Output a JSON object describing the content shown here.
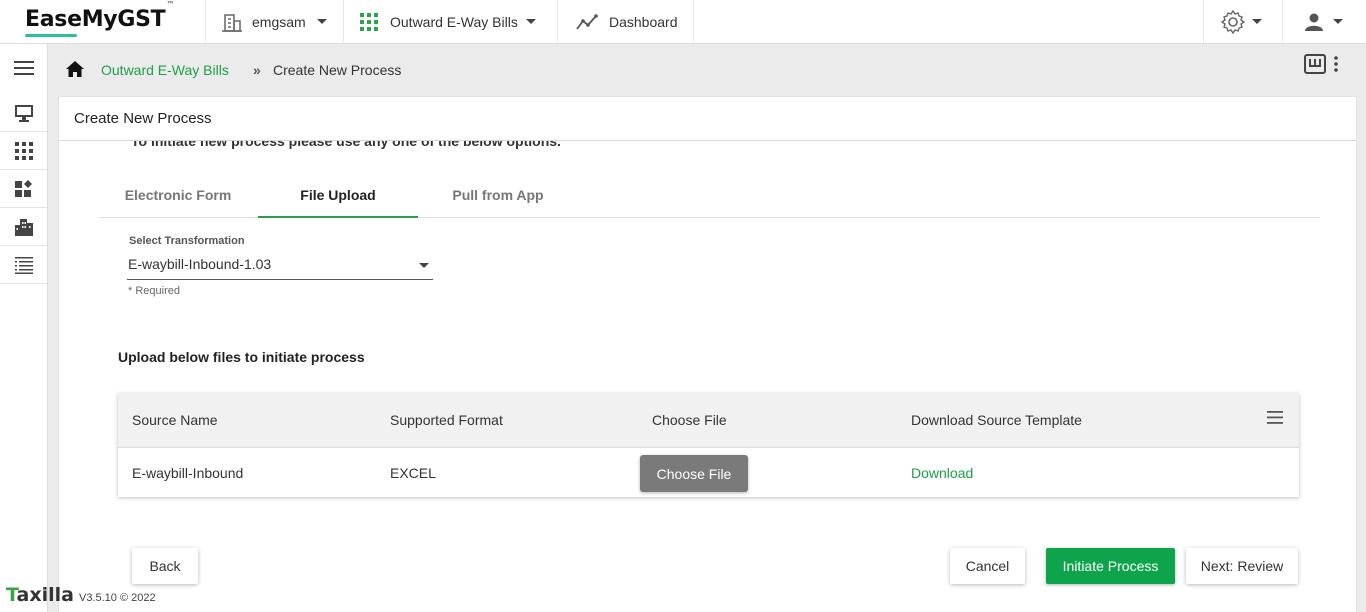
{
  "app": {
    "name": "EaseMyGST",
    "trademark": "™"
  },
  "topbar": {
    "org": "emgsam",
    "module": "Outward E-Way Bills",
    "dashboard": "Dashboard"
  },
  "breadcrumb": {
    "link": "Outward E-Way Bills",
    "separator": "»",
    "current": "Create New Process"
  },
  "card": {
    "title": "Create New Process",
    "intro": "To initiate new process please use any one of the below options."
  },
  "tabs": [
    {
      "label": "Electronic Form",
      "active": false
    },
    {
      "label": "File Upload",
      "active": true
    },
    {
      "label": "Pull from App",
      "active": false
    }
  ],
  "transformation": {
    "label": "Select Transformation",
    "value": "E-waybill-Inbound-1.03",
    "hint": "* Required"
  },
  "upload": {
    "heading": "Upload below files to initiate process",
    "columns": [
      "Source Name",
      "Supported Format",
      "Choose File",
      "Download Source Template"
    ],
    "rows": [
      {
        "source": "E-waybill-Inbound",
        "format": "EXCEL",
        "choose": "Choose File",
        "download": "Download"
      }
    ]
  },
  "actions": {
    "back": "Back",
    "cancel": "Cancel",
    "initiate": "Initiate Process",
    "next": "Next: Review"
  },
  "footer": {
    "brand_lead": "T",
    "brand_rest": "axilla",
    "version": "V3.5.10 © 2022"
  },
  "colors": {
    "accent": "#0ea44b",
    "link": "#1e9e4a",
    "logo_underline": "#2bbfa0"
  },
  "icons": [
    "building-icon",
    "grid-icon",
    "trend-icon",
    "gear-icon",
    "user-icon",
    "hamburger-icon",
    "monitor-icon",
    "apps-icon",
    "widgets-icon",
    "city-icon",
    "list-icon",
    "home-icon",
    "keyboard-icon",
    "kebab-icon",
    "column-menu-icon"
  ]
}
